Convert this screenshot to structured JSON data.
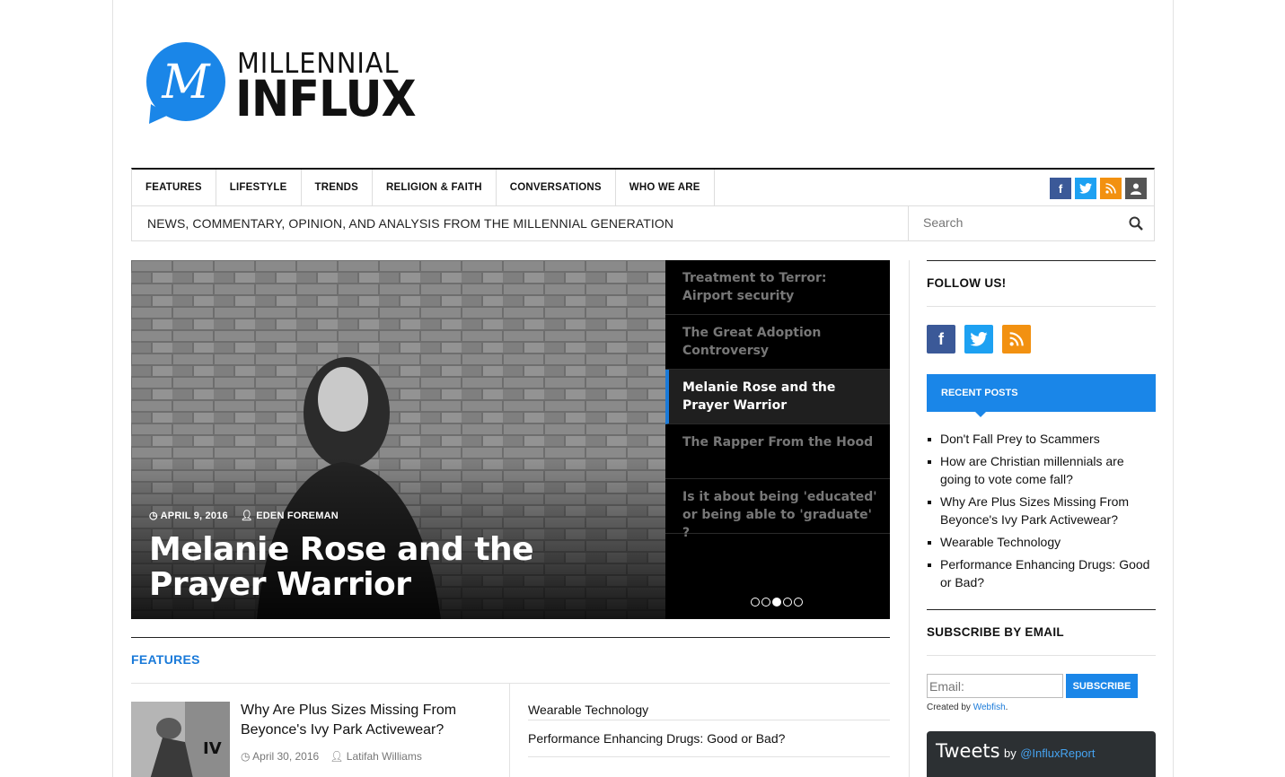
{
  "logo": {
    "line1": "MILLENNIAL",
    "line2": "INFLUX",
    "glyph": "M"
  },
  "nav": {
    "items": [
      "FEATURES",
      "LIFESTYLE",
      "TRENDS",
      "RELIGION & FAITH",
      "CONVERSATIONS",
      "WHO WE ARE"
    ],
    "social_icons": [
      "facebook-icon",
      "twitter-icon",
      "rss-icon",
      "user-icon"
    ]
  },
  "tagline": "NEWS, COMMENTARY, OPINION, AND ANALYSIS FROM THE MILLENNIAL GENERATION",
  "search": {
    "placeholder": "Search"
  },
  "slider": {
    "date": "APRIL 9, 2016",
    "author": "EDEN FOREMAN",
    "title": "Melanie Rose and the Prayer Warrior",
    "items": [
      "Treatment to Terror: Airport security",
      "The Great Adoption Controversy",
      "Melanie Rose and the Prayer Warrior",
      "The Rapper From the Hood",
      "Is it about being 'educated' or being able to 'graduate' ?"
    ],
    "active_index": 2
  },
  "features": {
    "heading": "FEATURES",
    "main_title": "Why Are Plus Sizes Missing From Beyonce's Ivy Park Activewear?",
    "main_date": "April 30, 2016",
    "main_author": "Latifah Williams",
    "list": [
      "Wearable Technology",
      "Performance Enhancing Drugs: Good or Bad?"
    ]
  },
  "sidebar": {
    "follow_heading": "FOLLOW US!",
    "recent_heading": "RECENT POSTS",
    "recent_posts": [
      "Don't Fall Prey to Scammers",
      "How are Christian millennials are going to vote come fall?",
      "Why Are Plus Sizes Missing From Beyonce's Ivy Park Activewear?",
      "Wearable Technology",
      "Performance Enhancing Drugs: Good or Bad?"
    ],
    "subscribe_heading": "SUBSCRIBE BY EMAIL",
    "email_placeholder": "Email:",
    "subscribe_label": "SUBSCRIBE",
    "created_by": "Created by ",
    "created_link": "Webfish",
    "created_end": ".",
    "tweets_label": "Tweets",
    "tweets_by": "by",
    "tweets_handle": "@InfluxReport"
  },
  "colors": {
    "accent": "#1a86e8",
    "facebook": "#3b5998",
    "twitter": "#1da1f2",
    "rss": "#f29111",
    "user": "#555555"
  }
}
